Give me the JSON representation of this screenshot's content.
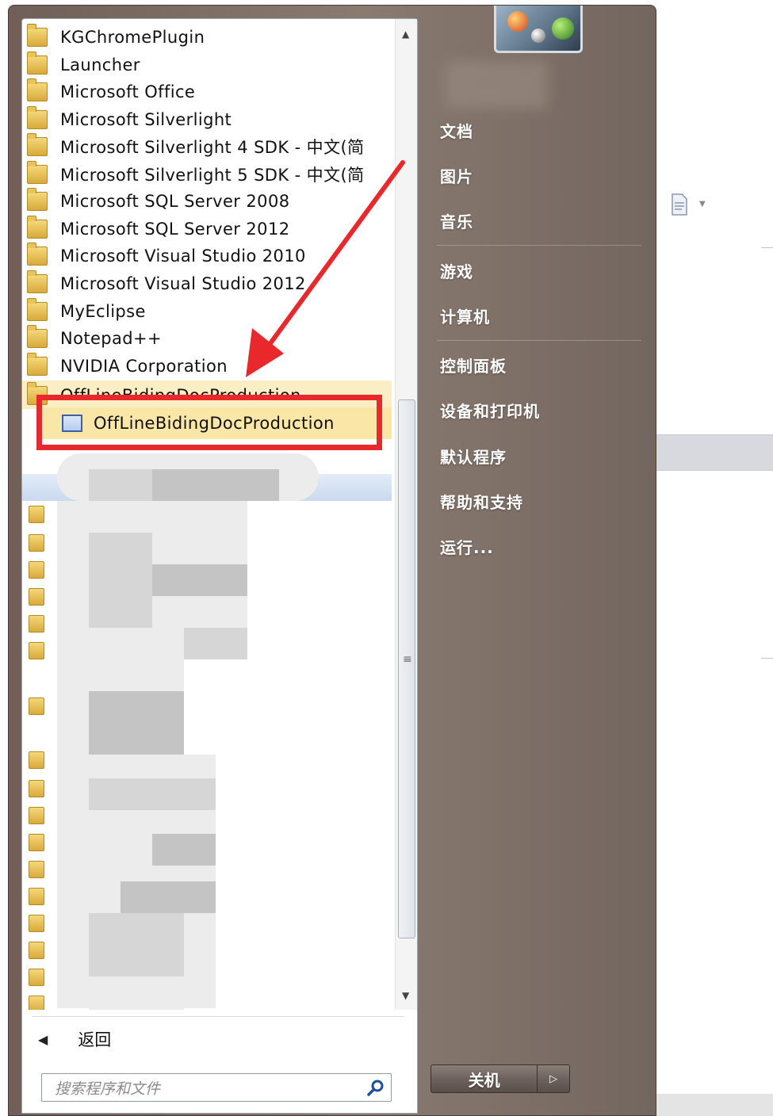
{
  "programs": [
    {
      "label": "KGChromePlugin"
    },
    {
      "label": "Launcher"
    },
    {
      "label": "Microsoft Office"
    },
    {
      "label": "Microsoft Silverlight"
    },
    {
      "label": "Microsoft Silverlight 4 SDK - 中文(简"
    },
    {
      "label": "Microsoft Silverlight 5 SDK - 中文(简"
    },
    {
      "label": "Microsoft SQL Server 2008"
    },
    {
      "label": "Microsoft SQL Server 2012"
    },
    {
      "label": "Microsoft Visual Studio 2010"
    },
    {
      "label": "Microsoft Visual Studio 2012"
    },
    {
      "label": "MyEclipse"
    },
    {
      "label": "Notepad++"
    },
    {
      "label": "NVIDIA Corporation"
    }
  ],
  "expanded_folder": {
    "label": "OffLineBidingDocProduction"
  },
  "selected_item": {
    "label": "OffLineBidingDocProduction"
  },
  "back": {
    "label": "返回"
  },
  "search": {
    "placeholder": "搜索程序和文件"
  },
  "right_pane": {
    "items": [
      "文档",
      "图片",
      "音乐",
      "游戏",
      "计算机",
      "控制面板",
      "设备和打印机",
      "默认程序",
      "帮助和支持",
      "运行..."
    ]
  },
  "shutdown": {
    "label": "关机"
  },
  "colors": {
    "highlight": "#e8282b",
    "selection": "#fae6a6"
  },
  "icons": [
    "folder-icon",
    "app-window-icon",
    "search-icon",
    "back-arrow-icon",
    "shutdown-options-icon",
    "user-picture",
    "document-icon"
  ]
}
